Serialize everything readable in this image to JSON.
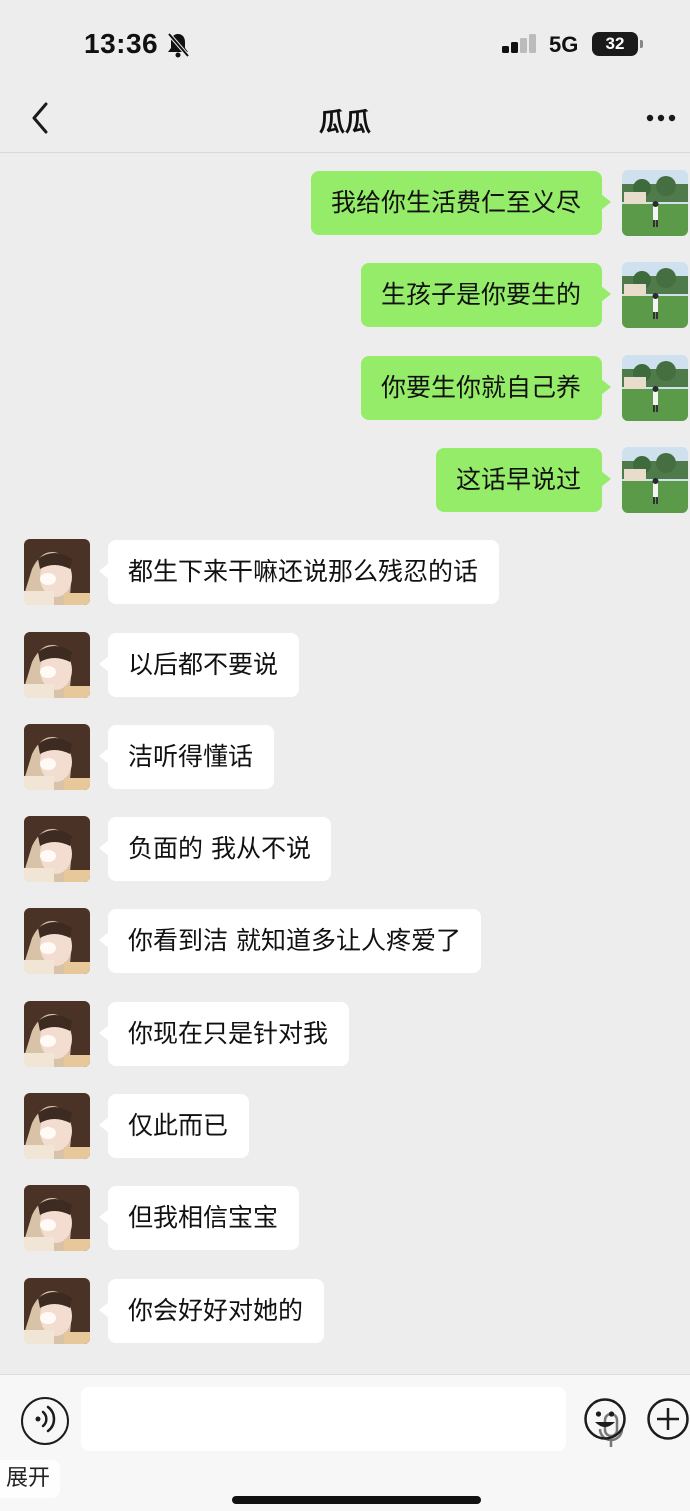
{
  "status_bar": {
    "time": "13:36",
    "network": "5G",
    "battery": "32",
    "icons": [
      "bell-muted-icon",
      "signal-icon",
      "battery-icon"
    ]
  },
  "nav": {
    "title": "瓜瓜",
    "icons": [
      "chevron-left-icon",
      "more-icon"
    ]
  },
  "colors": {
    "outgoing_bubble": "#95ec69",
    "incoming_bubble": "#ffffff",
    "background": "#ededed"
  },
  "messages": [
    {
      "sender": "me",
      "text": "我给你生活费仁至义尽"
    },
    {
      "sender": "me",
      "text": "生孩子是你要生的"
    },
    {
      "sender": "me",
      "text": "你要生你就自己养"
    },
    {
      "sender": "me",
      "text": "这话早说过"
    },
    {
      "sender": "other",
      "text": "都生下来干嘛还说那么残忍的话"
    },
    {
      "sender": "other",
      "text": "以后都不要说"
    },
    {
      "sender": "other",
      "text": "洁听得懂话"
    },
    {
      "sender": "other",
      "text": "负面的 我从不说"
    },
    {
      "sender": "other",
      "text": "你看到洁 就知道多让人疼爱了"
    },
    {
      "sender": "other",
      "text": "你现在只是针对我"
    },
    {
      "sender": "other",
      "text": "仅此而已"
    },
    {
      "sender": "other",
      "text": "但我相信宝宝"
    },
    {
      "sender": "other",
      "text": "你会好好对她的"
    }
  ],
  "input_bar": {
    "icons": [
      "voice-icon",
      "microphone-icon",
      "emoji-icon",
      "plus-icon"
    ]
  },
  "expand_label": "展开"
}
